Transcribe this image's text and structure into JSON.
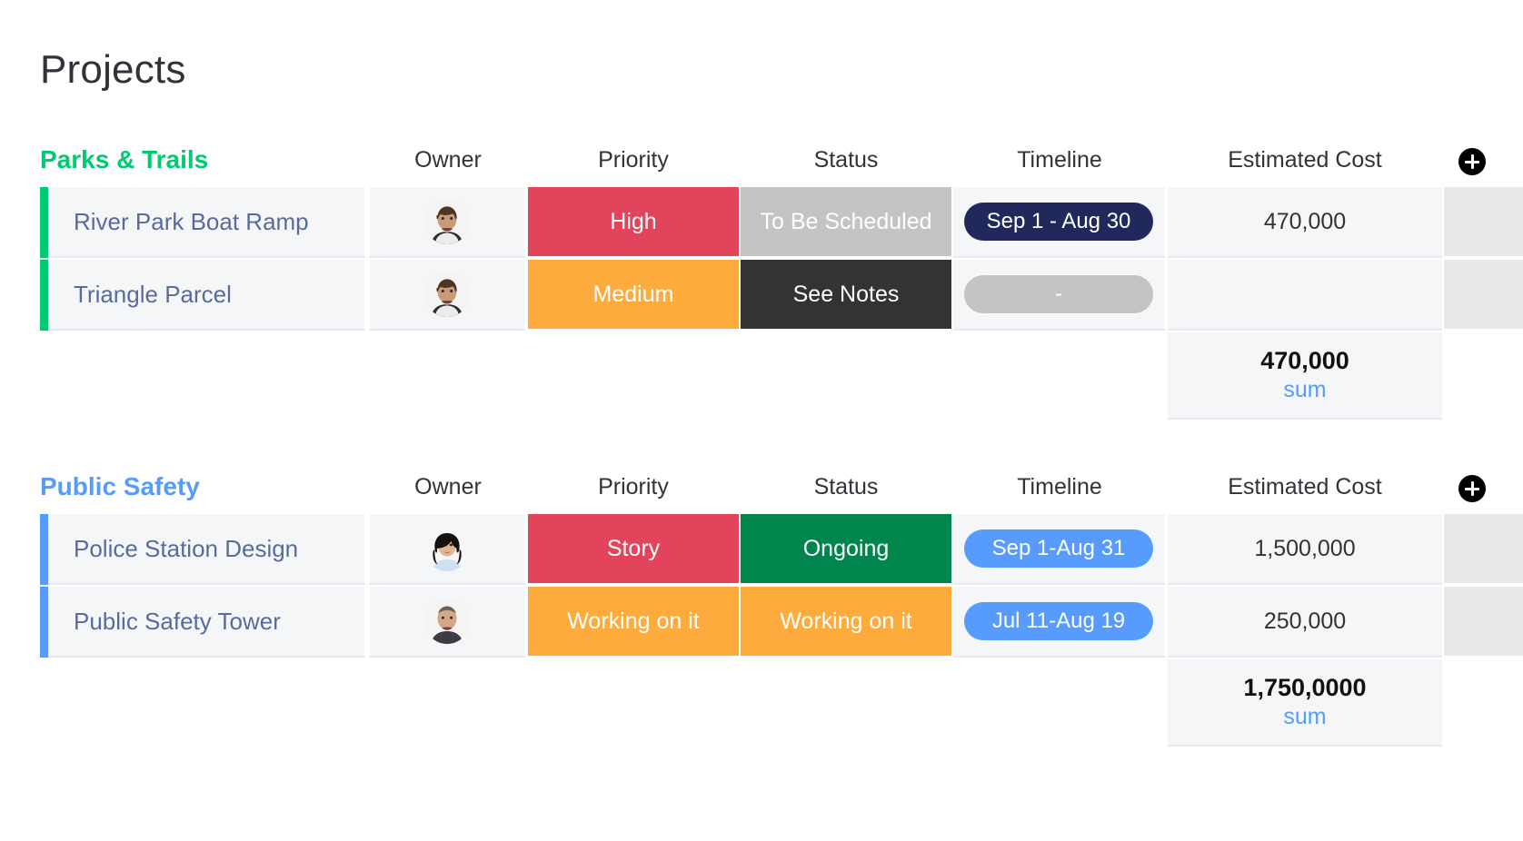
{
  "page": {
    "title": "Projects"
  },
  "columns": {
    "owner": "Owner",
    "priority": "Priority",
    "status": "Status",
    "timeline": "Timeline",
    "cost": "Estimated Cost",
    "add_icon": "plus-icon"
  },
  "colors": {
    "green": "#00ca72",
    "blue": "#579bfc",
    "red": "#e2445c",
    "orange": "#fdab3d",
    "gray": "#c4c4c4",
    "dark": "#333333",
    "navy": "#21295c",
    "dark_green": "#00854d",
    "sum_label": "#579bfc",
    "row_name": "#576c9c"
  },
  "groups": [
    {
      "name": "Parks & Trails",
      "color": "#00ca72",
      "rows": [
        {
          "name": "River Park Boat Ramp",
          "owner_avatar": "man-avatar",
          "priority": {
            "label": "High",
            "color": "#e2445c"
          },
          "status": {
            "label": "To Be Scheduled",
            "color": "#c4c4c4"
          },
          "timeline": {
            "label": "Sep 1 - Aug 30",
            "color": "#21295c"
          },
          "cost": "470,000"
        },
        {
          "name": "Triangle Parcel",
          "owner_avatar": "man-avatar",
          "priority": {
            "label": "Medium",
            "color": "#fdab3d"
          },
          "status": {
            "label": "See Notes",
            "color": "#333333"
          },
          "timeline": {
            "label": "-",
            "color": "#c4c4c4"
          },
          "cost": ""
        }
      ],
      "summary": {
        "value": "470,000",
        "label": "sum"
      }
    },
    {
      "name": "Public Safety",
      "color": "#579bfc",
      "rows": [
        {
          "name": "Police Station Design",
          "owner_avatar": "woman-avatar",
          "priority": {
            "label": "Story",
            "color": "#e2445c"
          },
          "status": {
            "label": "Ongoing",
            "color": "#00854d"
          },
          "timeline": {
            "label": "Sep 1-Aug 31",
            "color": "#579bfc"
          },
          "cost": "1,500,000"
        },
        {
          "name": "Public Safety Tower",
          "owner_avatar": "man-avatar",
          "priority": {
            "label": "Working on it",
            "color": "#fdab3d"
          },
          "status": {
            "label": "Working on it",
            "color": "#fdab3d"
          },
          "timeline": {
            "label": "Jul 11-Aug 19",
            "color": "#579bfc"
          },
          "cost": "250,000"
        }
      ],
      "summary": {
        "value": "1,750,0000",
        "label": "sum"
      }
    }
  ]
}
